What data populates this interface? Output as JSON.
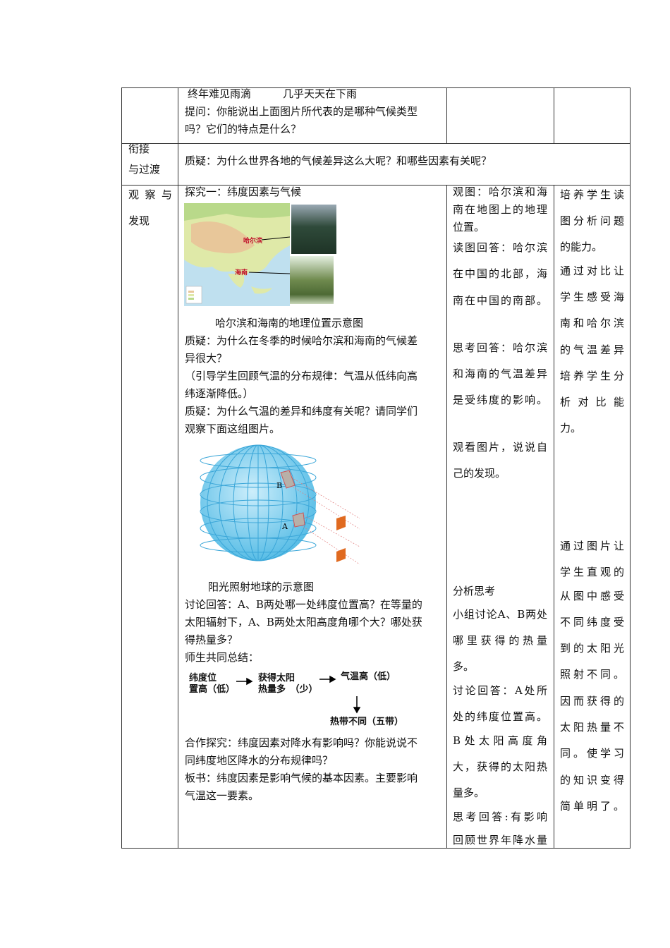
{
  "row_top": {
    "col2": [
      "终年难见雨滴　　　几乎天天在下雨",
      "提问：你能说出上面图片所代表的是哪种气候类型",
      "吗？它们的特点是什么？"
    ]
  },
  "row_transition": {
    "label": [
      "衔接",
      "与过渡"
    ],
    "text": "质疑：为什么世界各地的气候差异这么大呢？和哪些因素有关呢？"
  },
  "row_observe": {
    "label": [
      "观察与",
      "发现"
    ],
    "col2": {
      "heading": "探究一：纬度因素与气候",
      "map_labels": {
        "harbin": "哈尔滨",
        "hainan": "海南"
      },
      "map_caption": "哈尔滨和海南的地理位置示意图",
      "para1": [
        "质疑：为什么在冬季的时候哈尔滨和海南的气候差",
        "异很大？",
        "（引导学生回顾气温的分布规律：气温从低纬向高",
        "纬逐渐降低。）",
        "质疑：为什么气温的差异和纬度有关呢？请同学们",
        "观察下面这组图片。"
      ],
      "globe_labels": {
        "a": "A",
        "b": "B"
      },
      "globe_caption": "阳光照射地球的示意图",
      "para2": [
        "讨论回答：A、B两处哪一处纬度位置高？在等量的",
        "太阳辐射下，A、B两处太阳高度角哪个大？哪处获",
        "得热量多？",
        "师生共同总结："
      ],
      "flow": {
        "box1": [
          "纬度位",
          "置高（低）"
        ],
        "box2": [
          "获得太阳",
          "热量多　（少）"
        ],
        "box3": "气温高（低）",
        "box4": "热带不同（五带）"
      },
      "para3": [
        "合作探究：纬度因素对降水有影响吗？你能说说不",
        "同纬度地区降水的分布规律吗？",
        "板书：纬度因素是影响气候的基本因素。主要影响",
        "气温这一要素。"
      ]
    },
    "col3": [
      "观图：哈尔滨和海",
      "南在地图上的地理",
      "位置。",
      "读图回答：哈尔滨",
      "在中国的北部，海",
      "南在中国的南部。",
      "思考回答：哈尔滨",
      "和海南的气温差异",
      "是受纬度的影响。",
      "观看图片，说说自",
      "己的发现。",
      "分析思考",
      "小组讨论A、B两处",
      "哪里获得的热量",
      "多。",
      "讨论回答：A处所",
      "处的纬度位置高。",
      "B处太阳高度角",
      "大，获得的太阳热",
      "量多。",
      "思考回答:有影响",
      "回顾世界年降水量"
    ],
    "col4": [
      "培养学生读",
      "图分析问题",
      "的能力。",
      "通过对比让",
      "学生感受海",
      "南和哈尔滨",
      "的气温差异",
      "培养学生分",
      "析对比能",
      "力。",
      "通过图片让",
      "学生直观的",
      "从图中感受",
      "不同纬度受",
      "到的太阳光",
      "照射不同。",
      "因而获得的",
      "太阳热量不",
      "同。使学习",
      "的知识变得",
      "简单明了。"
    ]
  }
}
